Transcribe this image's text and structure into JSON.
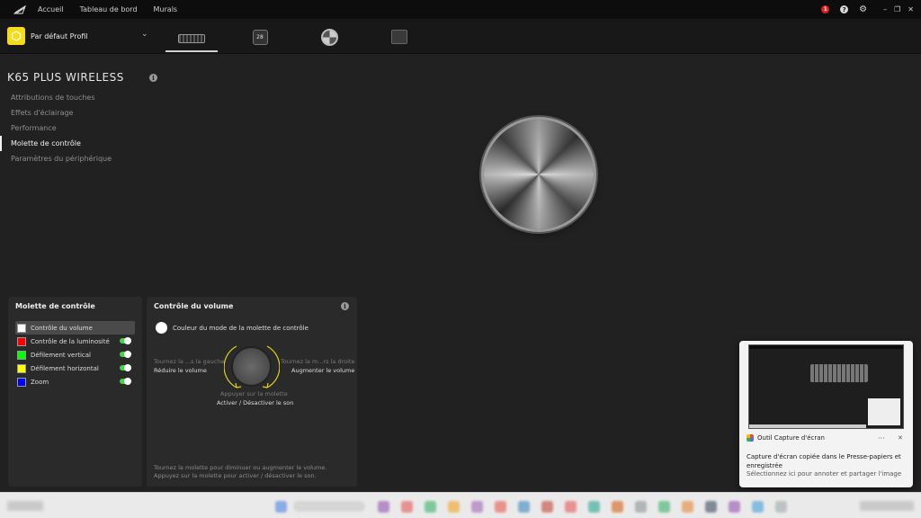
{
  "nav": {
    "items": [
      "Accueil",
      "Tableau de bord",
      "Murals"
    ]
  },
  "topbar": {
    "notification_count": "1",
    "help_glyph": "?",
    "icons": [
      "corsair-logo-icon",
      "notification-icon",
      "help-icon",
      "gear-icon",
      "minimize-icon",
      "restore-icon",
      "close-icon"
    ]
  },
  "profile": {
    "name": "Par défaut Profil",
    "icon_color": "#f5dc1a"
  },
  "devices": {
    "ls_label": "28"
  },
  "device": {
    "title": "K65 PLUS WIRELESS",
    "info_glyph": "i"
  },
  "menu": {
    "items": [
      "Attributions de touches",
      "Effets d'éclairage",
      "Performance",
      "Molette de contrôle",
      "Paramètres du périphérique"
    ],
    "active_index": 3
  },
  "left_panel": {
    "title": "Molette de contrôle",
    "modes": [
      {
        "label": "Contrôle du volume",
        "color": "#ffffff",
        "selected": true
      },
      {
        "label": "Contrôle de la luminosité",
        "color": "#ff0000",
        "enabled": true
      },
      {
        "label": "Défilement vertical",
        "color": "#00ff00",
        "enabled": true
      },
      {
        "label": "Défilement horizontal",
        "color": "#ffff00",
        "enabled": true
      },
      {
        "label": "Zoom",
        "color": "#0000ff",
        "enabled": true
      }
    ],
    "toggle_color": "#3fd64b"
  },
  "right_panel": {
    "title": "Contrôle du volume",
    "info_glyph": "i",
    "color_label": "Couleur du mode de la molette de contrôle",
    "left_action_dim": "Tournez la ...s la gauche",
    "left_action": "Réduire le volume",
    "right_action_dim": "Tournez la m...rs la droite",
    "right_action": "Augmenter le volume",
    "press_dim": "Appuyer sur la molette",
    "press_action": "Activer / Désactiver le son",
    "hint_line1": "Tournez la molette pour diminuer ou augmenter le volume.",
    "hint_line2": "Appuyez sur la molette pour activer / désactiver le son.",
    "arrow_color": "#e5d21a"
  },
  "toast": {
    "app_name": "Outil Capture d'écran",
    "more": "···",
    "close": "✕",
    "message": "Capture d'écran copiée dans le Presse-papiers et enregistrée",
    "sub": "Sélectionnez ici pour annoter et partager l'image"
  },
  "taskbar": {
    "icon_colors": [
      "#3a7be0",
      "#3a7be0",
      "#8e44ad",
      "#e84a4a",
      "#27ae60",
      "#f39c12",
      "#9b59b6",
      "#e74c3c",
      "#2980b9",
      "#c0392b",
      "#e84a4a",
      "#16a085",
      "#d35400",
      "#7f8c8d",
      "#27ae60",
      "#e67e22",
      "#2c3e50",
      "#8e44ad",
      "#3498db",
      "#95a5a6"
    ]
  }
}
